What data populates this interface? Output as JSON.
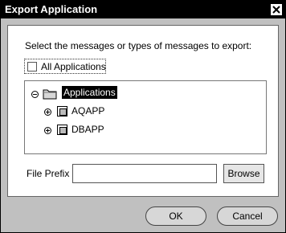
{
  "window": {
    "title": "Export Application"
  },
  "prompt": "Select the messages or types of messages to export:",
  "all_applications": {
    "label": "All Applications",
    "checked": false
  },
  "tree": {
    "root": {
      "label": "Applications",
      "expanded": true,
      "selected": true
    },
    "children": [
      {
        "label": "AQAPP",
        "expanded": false
      },
      {
        "label": "DBAPP",
        "expanded": false
      }
    ]
  },
  "file_prefix": {
    "label": "File Prefix",
    "value": "",
    "browse_label": "Browse"
  },
  "footer": {
    "ok_label": "OK",
    "cancel_label": "Cancel"
  },
  "icons": {
    "close": "close-icon",
    "folder": "folder-icon",
    "expand_minus": "collapse-icon",
    "expand_plus": "expand-icon",
    "app": "application-icon"
  }
}
